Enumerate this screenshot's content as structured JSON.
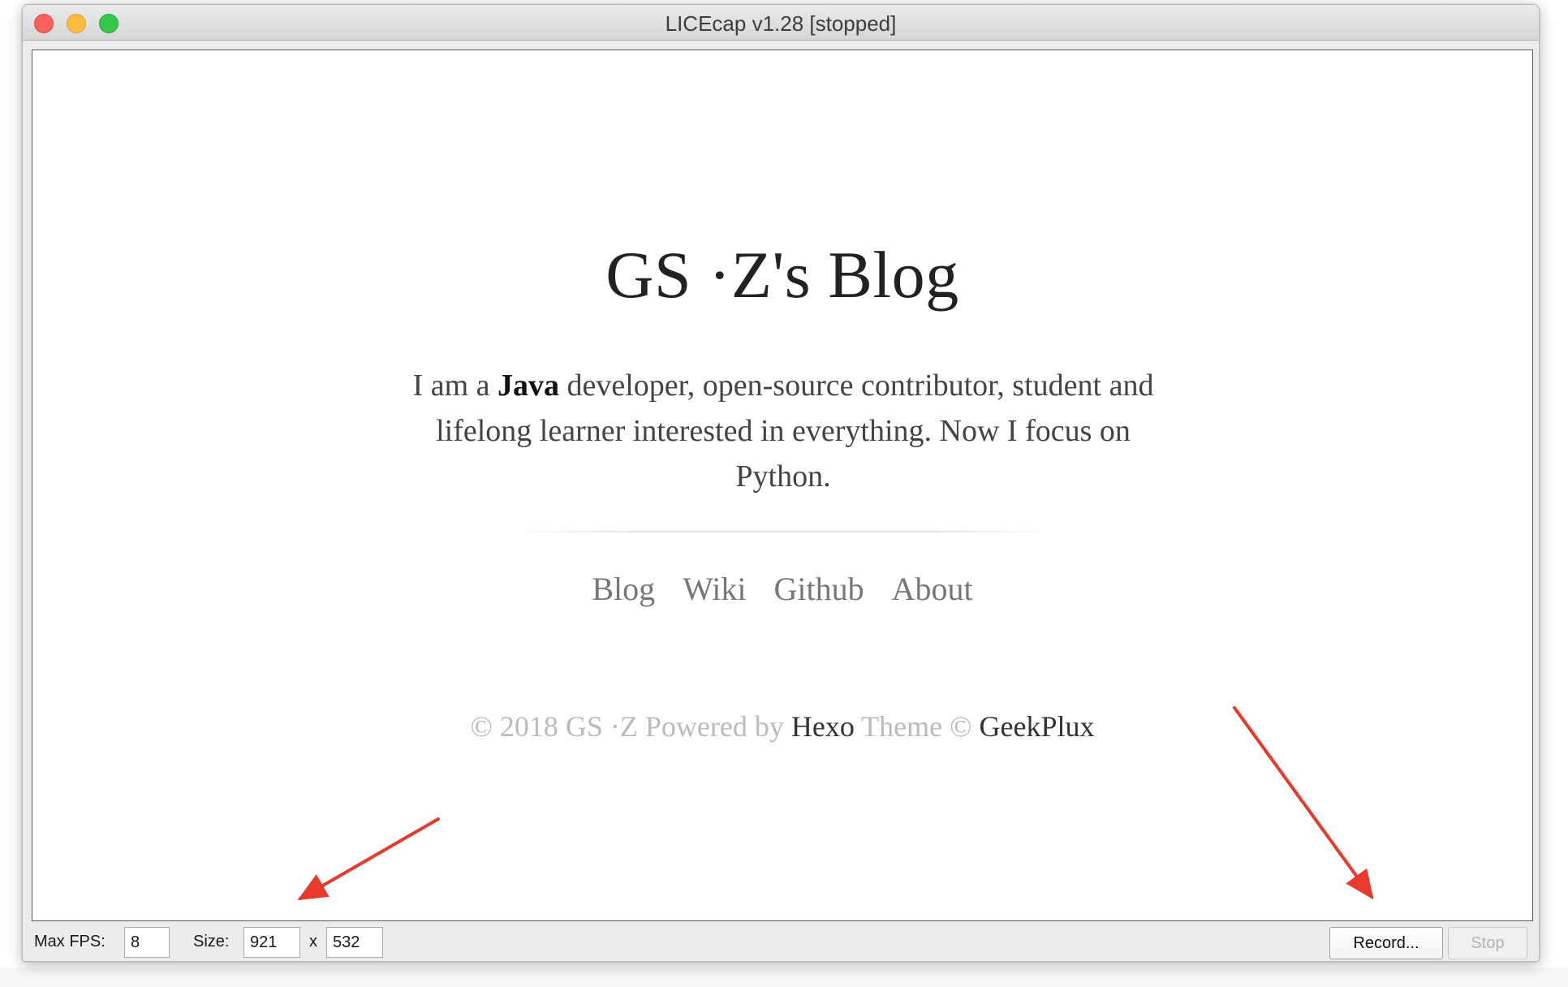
{
  "window": {
    "title": "LICEcap v1.28 [stopped]"
  },
  "blog": {
    "title": "GS ·Z's Blog",
    "description_pre": "I am a ",
    "description_bold": "Java",
    "description_line1_post": " developer, open-source contributor, student and",
    "description_line2": "lifelong learner interested in everything. Now I focus on",
    "description_line3": "Python.",
    "nav": [
      "Blog",
      "Wiki",
      "Github",
      "About"
    ],
    "footer": {
      "prefix": "© 2018 GS ·Z Powered by ",
      "hexo": "Hexo",
      "middle": " Theme © ",
      "geekplux": "GeekPlux"
    }
  },
  "controls": {
    "max_fps_label": "Max FPS:",
    "max_fps_value": "8",
    "size_label": "Size:",
    "width_value": "921",
    "times": "x",
    "height_value": "532",
    "record_label": "Record...",
    "stop_label": "Stop"
  },
  "colors": {
    "annotation_arrow": "#e8392c",
    "close": "#fc605c",
    "minimize": "#fdbc40",
    "zoom": "#34c84a"
  },
  "icons": [
    "close-icon",
    "minimize-icon",
    "zoom-icon",
    "annotation-arrow-icon"
  ]
}
